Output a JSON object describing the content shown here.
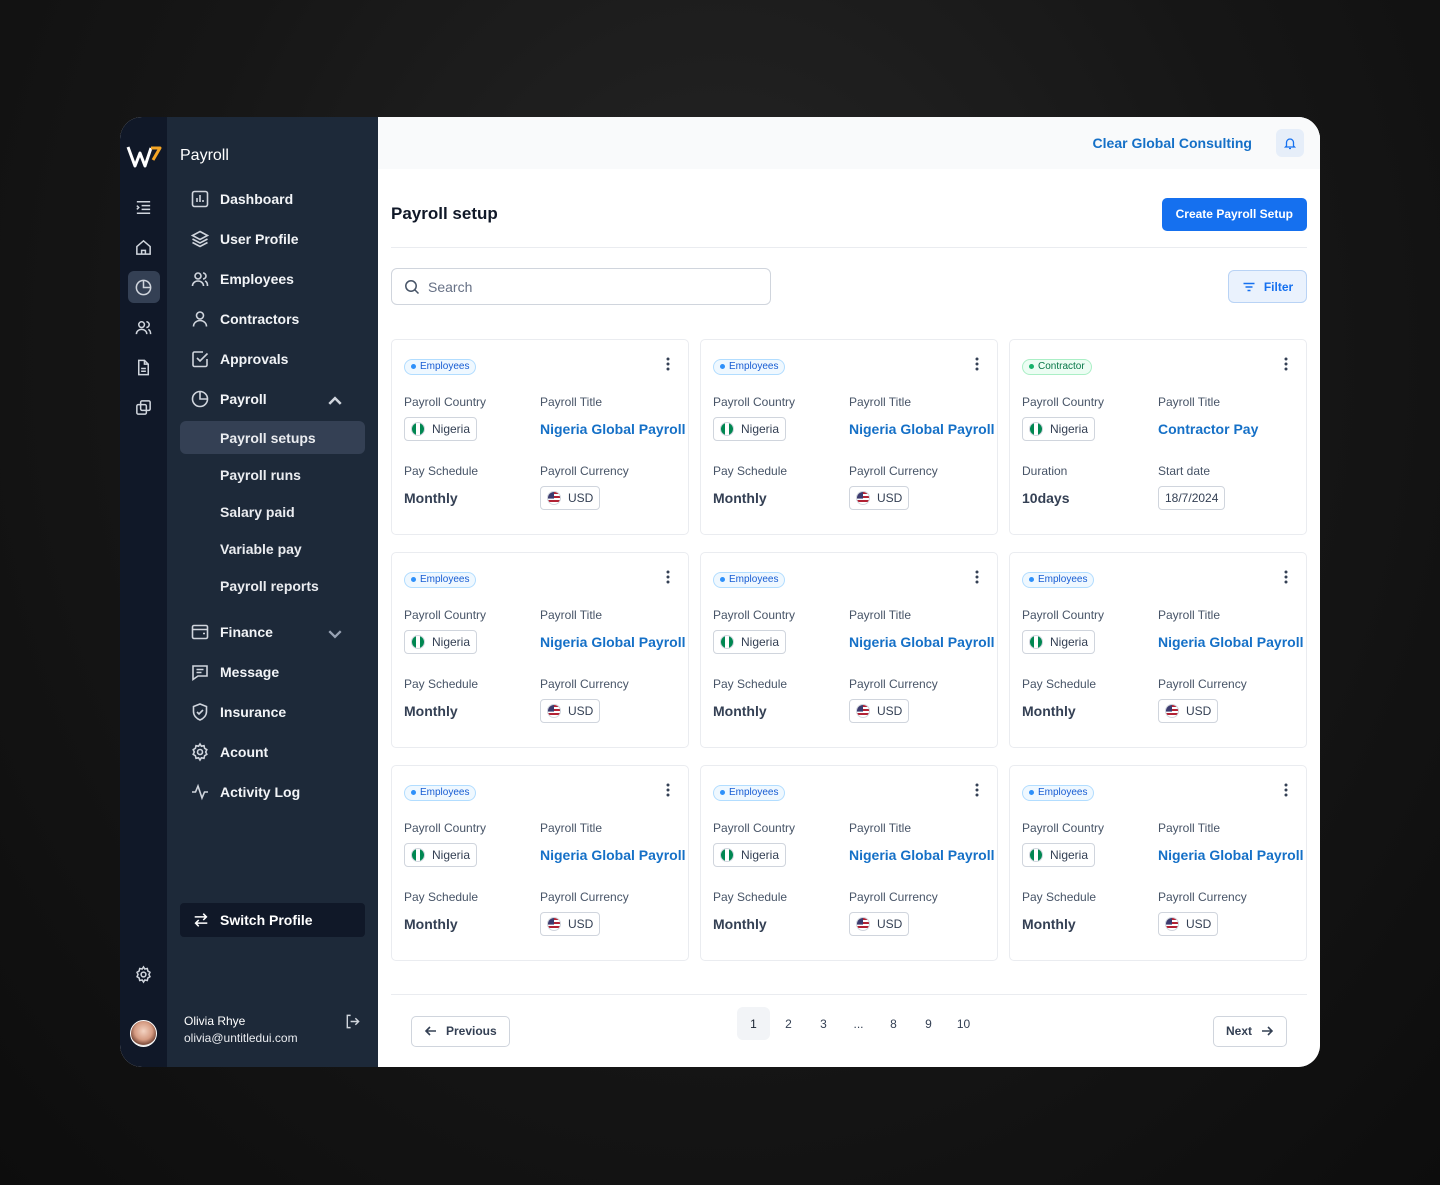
{
  "sidebar": {
    "title": "Payroll",
    "items": [
      {
        "label": "Dashboard"
      },
      {
        "label": "User Profile"
      },
      {
        "label": "Employees"
      },
      {
        "label": "Contractors"
      },
      {
        "label": "Approvals"
      },
      {
        "label": "Payroll"
      }
    ],
    "payroll_sub": [
      {
        "label": "Payroll setups",
        "active": true
      },
      {
        "label": "Payroll runs"
      },
      {
        "label": "Salary paid"
      },
      {
        "label": "Variable pay"
      },
      {
        "label": "Payroll reports"
      }
    ],
    "items_after": [
      {
        "label": "Finance"
      },
      {
        "label": "Message"
      },
      {
        "label": "Insurance"
      },
      {
        "label": "Acount"
      },
      {
        "label": "Activity Log"
      }
    ],
    "switch_profile": "Switch Profile",
    "user": {
      "name": "Olivia Rhye",
      "email": "olivia@untitledui.com"
    }
  },
  "topbar": {
    "org_name": "Clear Global Consulting"
  },
  "page": {
    "title": "Payroll setup",
    "create_button": "Create Payroll Setup",
    "search_placeholder": "Search",
    "filter_label": "Filter"
  },
  "cards": [
    {
      "badge": "Employees",
      "type": "employee",
      "country_label": "Payroll Country",
      "country": "Nigeria",
      "title_label": "Payroll Title",
      "title": "Nigeria Global Payroll",
      "f3_label": "Pay Schedule",
      "f3": "Monthly",
      "f4_label": "Payroll Currency",
      "f4": "USD"
    },
    {
      "badge": "Employees",
      "type": "employee",
      "country_label": "Payroll Country",
      "country": "Nigeria",
      "title_label": "Payroll Title",
      "title": "Nigeria Global Payroll",
      "f3_label": "Pay Schedule",
      "f3": "Monthly",
      "f4_label": "Payroll Currency",
      "f4": "USD"
    },
    {
      "badge": "Contractor",
      "type": "contractor",
      "country_label": "Payroll Country",
      "country": "Nigeria",
      "title_label": "Payroll Title",
      "title": "Contractor Pay",
      "f3_label": "Duration",
      "f3": "10days",
      "f4_label": "Start date",
      "f4": "18/7/2024"
    },
    {
      "badge": "Employees",
      "type": "employee",
      "country_label": "Payroll Country",
      "country": "Nigeria",
      "title_label": "Payroll Title",
      "title": "Nigeria Global Payroll",
      "f3_label": "Pay Schedule",
      "f3": "Monthly",
      "f4_label": "Payroll Currency",
      "f4": "USD"
    },
    {
      "badge": "Employees",
      "type": "employee",
      "country_label": "Payroll Country",
      "country": "Nigeria",
      "title_label": "Payroll Title",
      "title": "Nigeria Global Payroll",
      "f3_label": "Pay Schedule",
      "f3": "Monthly",
      "f4_label": "Payroll Currency",
      "f4": "USD"
    },
    {
      "badge": "Employees",
      "type": "employee",
      "country_label": "Payroll Country",
      "country": "Nigeria",
      "title_label": "Payroll Title",
      "title": "Nigeria Global Payroll",
      "f3_label": "Pay Schedule",
      "f3": "Monthly",
      "f4_label": "Payroll Currency",
      "f4": "USD"
    },
    {
      "badge": "Employees",
      "type": "employee",
      "country_label": "Payroll Country",
      "country": "Nigeria",
      "title_label": "Payroll Title",
      "title": "Nigeria Global Payroll",
      "f3_label": "Pay Schedule",
      "f3": "Monthly",
      "f4_label": "Payroll Currency",
      "f4": "USD"
    },
    {
      "badge": "Employees",
      "type": "employee",
      "country_label": "Payroll Country",
      "country": "Nigeria",
      "title_label": "Payroll Title",
      "title": "Nigeria Global Payroll",
      "f3_label": "Pay Schedule",
      "f3": "Monthly",
      "f4_label": "Payroll Currency",
      "f4": "USD"
    },
    {
      "badge": "Employees",
      "type": "employee",
      "country_label": "Payroll Country",
      "country": "Nigeria",
      "title_label": "Payroll Title",
      "title": "Nigeria Global Payroll",
      "f3_label": "Pay Schedule",
      "f3": "Monthly",
      "f4_label": "Payroll Currency",
      "f4": "USD"
    }
  ],
  "pagination": {
    "previous": "Previous",
    "next": "Next",
    "pages": [
      "1",
      "2",
      "3",
      "...",
      "8",
      "9",
      "10"
    ],
    "current": "1"
  },
  "icons": {
    "rail": [
      "menu-icon",
      "home-icon",
      "pie-chart-icon",
      "users-icon",
      "file-icon",
      "copy-icon",
      "settings-icon"
    ],
    "accent": "#1570ef",
    "sidebar_bg": "#1d2939",
    "rail_bg": "#101828"
  }
}
